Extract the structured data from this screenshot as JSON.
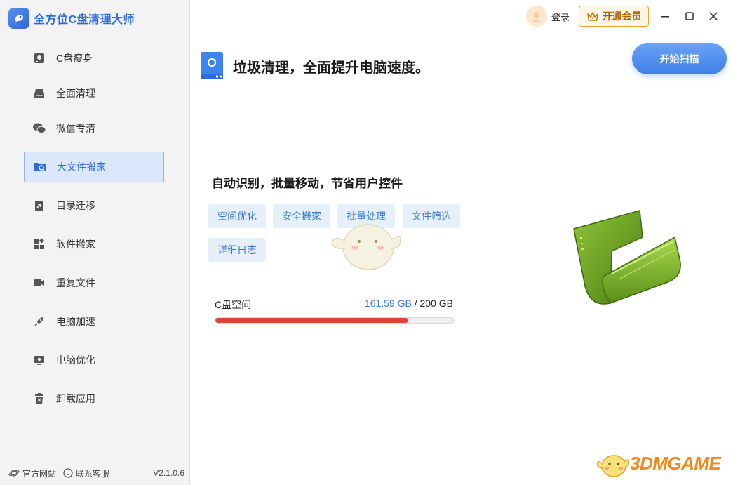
{
  "app": {
    "title": "全方位C盘清理大师",
    "version": "V2.1.0.6"
  },
  "sidebar": {
    "items": [
      {
        "label": "C盘瘦身",
        "icon": "disk-icon",
        "active": false
      },
      {
        "label": "全面清理",
        "icon": "drive-icon",
        "active": false
      },
      {
        "label": "微信专清",
        "icon": "wechat-icon",
        "active": false
      },
      {
        "label": "大文件搬家",
        "icon": "folder-move-icon",
        "active": true
      },
      {
        "label": "目录迁移",
        "icon": "migrate-icon",
        "active": false
      },
      {
        "label": "软件搬家",
        "icon": "apps-icon",
        "active": false
      },
      {
        "label": "重复文件",
        "icon": "duplicate-icon",
        "active": false
      },
      {
        "label": "电脑加速",
        "icon": "rocket-icon",
        "active": false
      },
      {
        "label": "电脑优化",
        "icon": "monitor-icon",
        "active": false
      },
      {
        "label": "卸载应用",
        "icon": "trash-icon",
        "active": false
      }
    ],
    "footer": {
      "website": "官方网站",
      "support": "联系客服"
    }
  },
  "topbar": {
    "login": "登录",
    "vip": "开通会员"
  },
  "main": {
    "headline": "垃圾清理，全面提升电脑速度。",
    "scan_button": "开始扫描",
    "subtitle": "自动识别，批量移动，节省用户控件",
    "tags": [
      "空间优化",
      "安全搬家",
      "批量处理",
      "文件筛选",
      "详细日志"
    ],
    "space": {
      "label": "C盘空间",
      "used": "161.59 GB",
      "separator": " / ",
      "total": "200 GB",
      "used_fraction": 0.808
    }
  },
  "watermark": "3DMGAME",
  "colors": {
    "accent": "#2d6ae0",
    "progress": "#e04236",
    "vip": "#f0a030"
  }
}
